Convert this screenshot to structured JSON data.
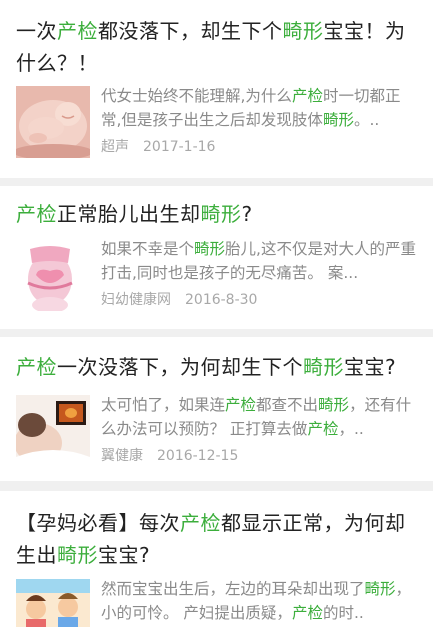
{
  "theme": {
    "highlight_color": "#3cae3c",
    "text_color": "#222222",
    "muted_color": "#8a8a8a",
    "background": "#f0f0f0"
  },
  "articles": [
    {
      "title": [
        {
          "t": "一次"
        },
        {
          "t": "产检",
          "hl": true
        },
        {
          "t": "都没落下，却生下个"
        },
        {
          "t": "畸形",
          "hl": true
        },
        {
          "t": "宝宝！为什么？！"
        }
      ],
      "thumbnail": "sleeping-baby-image",
      "snippet": [
        {
          "t": "代女士始终不能理解,为什么"
        },
        {
          "t": "产检",
          "hl": true
        },
        {
          "t": "时一切都正常,但是孩子出生之后却发现肢体"
        },
        {
          "t": "畸形",
          "hl": true
        },
        {
          "t": "。.."
        }
      ],
      "source": "超声",
      "date": "2017-1-16"
    },
    {
      "title": [
        {
          "t": "产检",
          "hl": true
        },
        {
          "t": "正常胎儿出生却"
        },
        {
          "t": "畸形",
          "hl": true
        },
        {
          "t": "?"
        }
      ],
      "thumbnail": "pregnant-belly-image",
      "snippet": [
        {
          "t": "如果不幸是个"
        },
        {
          "t": "畸形",
          "hl": true
        },
        {
          "t": "胎儿,这不仅是对大人的严重打击,同时也是孩子的无尽痛苦。 案..."
        }
      ],
      "source": "妇幼健康网",
      "date": "2016-8-30"
    },
    {
      "title": [
        {
          "t": "产检",
          "hl": true
        },
        {
          "t": "一次没落下，为何却生下个"
        },
        {
          "t": "畸形",
          "hl": true
        },
        {
          "t": "宝宝?"
        }
      ],
      "thumbnail": "ultrasound-scan-image",
      "snippet": [
        {
          "t": "太可怕了，如果连"
        },
        {
          "t": "产检",
          "hl": true
        },
        {
          "t": "都查不出"
        },
        {
          "t": "畸形",
          "hl": true
        },
        {
          "t": "，还有什么办法可以预防？ 正打算去做"
        },
        {
          "t": "产检",
          "hl": true
        },
        {
          "t": "，.."
        }
      ],
      "source": "翼健康",
      "date": "2016-12-15"
    },
    {
      "title": [
        {
          "t": "【孕妈必看】每次"
        },
        {
          "t": "产检",
          "hl": true
        },
        {
          "t": "都显示正常，为何却生出"
        },
        {
          "t": "畸形",
          "hl": true
        },
        {
          "t": "宝宝?"
        }
      ],
      "thumbnail": "cartoon-illustration-image",
      "snippet": [
        {
          "t": "然而宝宝出生后，左边的耳朵却出现了"
        },
        {
          "t": "畸形",
          "hl": true
        },
        {
          "t": "，小的可怜。 产妇提出质疑，"
        },
        {
          "t": "产检",
          "hl": true
        },
        {
          "t": "的时.."
        }
      ],
      "source": "",
      "date": ""
    }
  ]
}
